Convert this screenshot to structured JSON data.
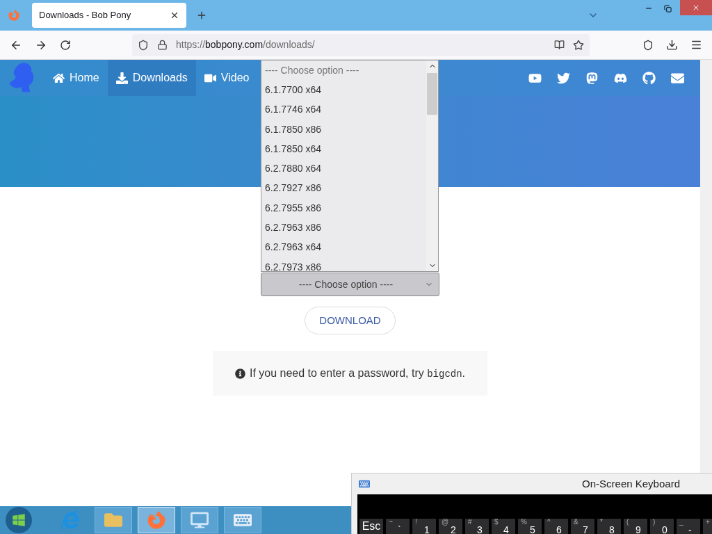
{
  "browser": {
    "tabs": [
      {
        "title": "Downloads - Bob Pony",
        "selected": true
      }
    ],
    "url": {
      "scheme": "https://",
      "host": "bobpony.com",
      "path": "/downloads/"
    }
  },
  "nav": {
    "items": [
      {
        "label": "Home",
        "selected": false
      },
      {
        "label": "Downloads",
        "selected": true
      },
      {
        "label": "Video",
        "selected": false
      }
    ]
  },
  "select": {
    "value": "---- Choose option ----",
    "expanded": true,
    "options": [
      "---- Choose option ----",
      "6.1.7700 x64",
      "6.1.7746 x64",
      "6.1.7850 x86",
      "6.1.7850 x64",
      "6.2.7880 x64",
      "6.2.7927 x86",
      "6.2.7955 x86",
      "6.2.7963 x86",
      "6.2.7963 x64",
      "6.2.7973 x86"
    ]
  },
  "download_button": "DOWNLOAD",
  "notice": {
    "before": "If you need to enter a password, try ",
    "code": "bigcdn",
    "after": "."
  },
  "keyboard": {
    "title": "On-Screen Keyboard",
    "keys": [
      {
        "main": "Esc"
      },
      {
        "top": "~",
        "main": "`"
      },
      {
        "top": "!",
        "main": "1"
      },
      {
        "top": "@",
        "main": "2"
      },
      {
        "top": "#",
        "main": "3"
      },
      {
        "top": "$",
        "main": "4"
      },
      {
        "top": "%",
        "main": "5"
      },
      {
        "top": "^",
        "main": "6"
      },
      {
        "top": "&",
        "main": "7"
      },
      {
        "top": "*",
        "main": "8"
      },
      {
        "top": "(",
        "main": "9"
      },
      {
        "top": ")",
        "main": "0"
      },
      {
        "top": "_",
        "main": "-"
      },
      {
        "top": "+"
      }
    ]
  },
  "taskbar": [
    {
      "selected": false
    },
    {
      "selected": false
    },
    {
      "selected": true
    },
    {
      "selected": false
    },
    {
      "selected": false
    }
  ]
}
